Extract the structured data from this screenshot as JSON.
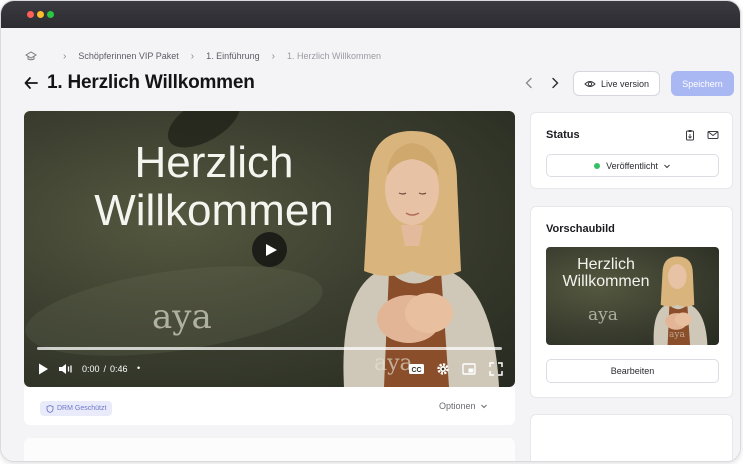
{
  "breadcrumb": {
    "items": [
      "Schöpferinnen VIP Paket",
      "1. Einführung",
      "1. Herzlich Willkommen"
    ]
  },
  "header": {
    "title": "1. Herzlich Willkommen",
    "live_label": "Live version",
    "save_label": "Speichern"
  },
  "video": {
    "headline_line1": "Herzlich",
    "headline_line2": "Willkommen",
    "logo_text": "aya",
    "current_time": "0:00",
    "duration": "0:46",
    "separator": "/",
    "dot": "•",
    "progress": 0,
    "drm_label": "DRM Geschützt",
    "options_label": "Optionen"
  },
  "status": {
    "title": "Status",
    "value": "Veröffentlicht",
    "dot_color": "#35c163"
  },
  "preview": {
    "title": "Vorschaubild",
    "thumb_line1": "Herzlich",
    "thumb_line2": "Willkommen",
    "thumb_logo": "aya",
    "edit_label": "Bearbeiten"
  },
  "colors": {
    "accent": "#a9b7f3",
    "drm_badge_bg": "#e9ebfb",
    "drm_badge_text": "#6f78c9"
  },
  "icons": [
    "home-icon",
    "back-arrow-icon",
    "chevron-left-icon",
    "chevron-right-icon",
    "eye-icon",
    "play-icon",
    "volume-icon",
    "cc-icon",
    "gear-icon",
    "pip-icon",
    "fullscreen-icon",
    "shield-icon",
    "chevron-down-icon",
    "copy-icon",
    "mail-icon"
  ]
}
